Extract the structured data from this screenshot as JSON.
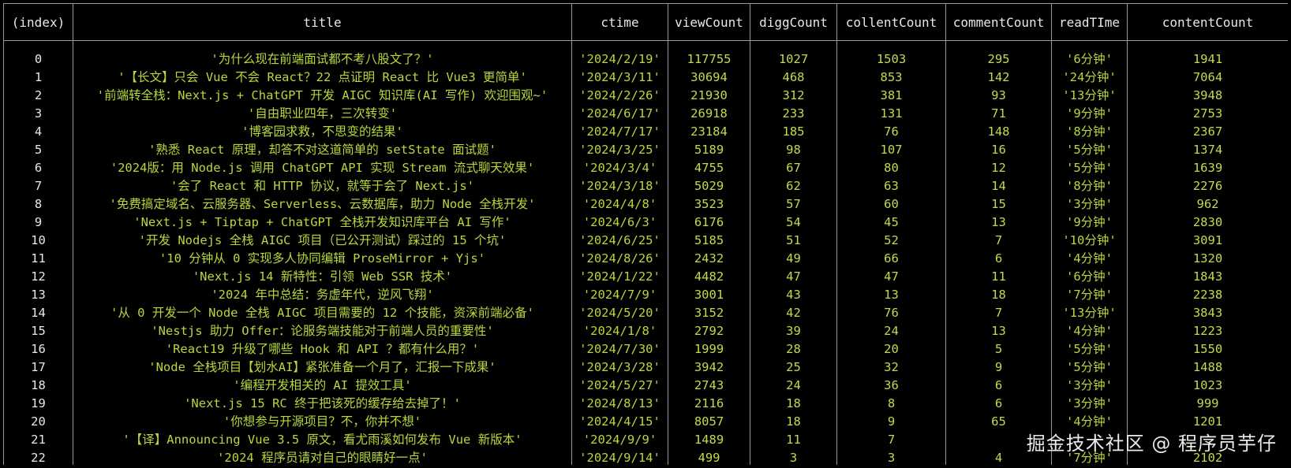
{
  "table": {
    "headers": [
      "(index)",
      "title",
      "ctime",
      "viewCount",
      "diggCount",
      "collentCount",
      "commentCount",
      "readTIme",
      "contentCount"
    ],
    "rows": [
      [
        "0",
        "'为什么现在前端面试都不考八股文了？'",
        "'2024/2/19'",
        "117755",
        "1027",
        "1503",
        "295",
        "'6分钟'",
        "1941"
      ],
      [
        "1",
        "'【长文】只会 Vue 不会 React？22 点证明 React 比 Vue3 更简单'",
        "'2024/3/11'",
        "30694",
        "468",
        "853",
        "142",
        "'24分钟'",
        "7064"
      ],
      [
        "2",
        "'前端转全栈：Next.js + ChatGPT 开发 AIGC 知识库(AI 写作) 欢迎围观~'",
        "'2024/2/26'",
        "21930",
        "312",
        "381",
        "93",
        "'13分钟'",
        "3948"
      ],
      [
        "3",
        "'自由职业四年，三次转变'",
        "'2024/6/17'",
        "26918",
        "233",
        "131",
        "71",
        "'9分钟'",
        "2753"
      ],
      [
        "4",
        "'博客园求救，不思变的结果'",
        "'2024/7/17'",
        "23184",
        "185",
        "76",
        "148",
        "'8分钟'",
        "2367"
      ],
      [
        "5",
        "'熟悉 React 原理，却答不对这道简单的 setState 面试题'",
        "'2024/3/25'",
        "5189",
        "98",
        "107",
        "16",
        "'5分钟'",
        "1374"
      ],
      [
        "6",
        "'2024版：用 Node.js 调用 ChatGPT API 实现 Stream 流式聊天效果'",
        "'2024/3/4'",
        "4755",
        "67",
        "80",
        "12",
        "'5分钟'",
        "1639"
      ],
      [
        "7",
        "'会了 React 和 HTTP 协议，就等于会了 Next.js'",
        "'2024/3/18'",
        "5029",
        "62",
        "63",
        "14",
        "'8分钟'",
        "2276"
      ],
      [
        "8",
        "'免费搞定域名、云服务器、Serverless、云数据库，助力 Node 全栈开发'",
        "'2024/4/8'",
        "3523",
        "57",
        "60",
        "15",
        "'3分钟'",
        "962"
      ],
      [
        "9",
        "'Next.js + Tiptap + ChatGPT 全栈开发知识库平台 AI 写作'",
        "'2024/6/3'",
        "6176",
        "54",
        "45",
        "13",
        "'9分钟'",
        "2830"
      ],
      [
        "10",
        "'开发 Nodejs 全栈 AIGC 项目（已公开测试）踩过的 15 个坑'",
        "'2024/6/25'",
        "5185",
        "51",
        "52",
        "7",
        "'10分钟'",
        "3091"
      ],
      [
        "11",
        "'10 分钟从 0 实现多人协同编辑 ProseMirror + Yjs'",
        "'2024/8/26'",
        "2432",
        "49",
        "66",
        "6",
        "'4分钟'",
        "1320"
      ],
      [
        "12",
        "'Next.js 14 新特性：引领 Web SSR 技术'",
        "'2024/1/22'",
        "4482",
        "47",
        "47",
        "11",
        "'6分钟'",
        "1843"
      ],
      [
        "13",
        "'2024 年中总结：务虚年代，逆风飞翔'",
        "'2024/7/9'",
        "3001",
        "43",
        "13",
        "18",
        "'7分钟'",
        "2238"
      ],
      [
        "14",
        "'从 0 开发一个 Node 全栈 AIGC 项目需要的 12 个技能，资深前端必备'",
        "'2024/5/20'",
        "3152",
        "42",
        "76",
        "7",
        "'13分钟'",
        "3843"
      ],
      [
        "15",
        "'Nestjs 助力 Offer：论服务端技能对于前端人员的重要性'",
        "'2024/1/8'",
        "2792",
        "39",
        "24",
        "13",
        "'4分钟'",
        "1223"
      ],
      [
        "16",
        "'React19 升级了哪些 Hook 和 API ？都有什么用？'",
        "'2024/7/30'",
        "1999",
        "28",
        "20",
        "5",
        "'5分钟'",
        "1550"
      ],
      [
        "17",
        "'Node 全栈项目【划水AI】紧张准备一个月了，汇报一下成果'",
        "'2024/3/28'",
        "3942",
        "25",
        "32",
        "9",
        "'5分钟'",
        "1488"
      ],
      [
        "18",
        "'编程开发相关的 AI 提效工具'",
        "'2024/5/27'",
        "2743",
        "24",
        "36",
        "6",
        "'3分钟'",
        "1023"
      ],
      [
        "19",
        "'Next.js 15 RC 终于把该死的缓存给去掉了！'",
        "'2024/8/13'",
        "2116",
        "18",
        "8",
        "6",
        "'3分钟'",
        "999"
      ],
      [
        "20",
        "'你想参与开源项目？不，你并不想'",
        "'2024/4/15'",
        "8057",
        "18",
        "9",
        "65",
        "'4分钟'",
        "1201"
      ],
      [
        "21",
        "'【译】Announcing Vue 3.5 原文，看尤雨溪如何发布 Vue 新版本'",
        "'2024/9/9'",
        "1489",
        "11",
        "7",
        "",
        "",
        ""
      ],
      [
        "22",
        "'2024 程序员请对自己的眼睛好一点'",
        "'2024/9/14'",
        "499",
        "3",
        "3",
        "4",
        "'7分钟'",
        "2102"
      ]
    ]
  },
  "watermark": {
    "text": "掘金技术社区 @ 程序员芋仔"
  },
  "colors": {
    "background": "#000000",
    "header_text": "#e8e8e8",
    "cell_text": "#c9d94a",
    "border": "#9a9a9a"
  }
}
